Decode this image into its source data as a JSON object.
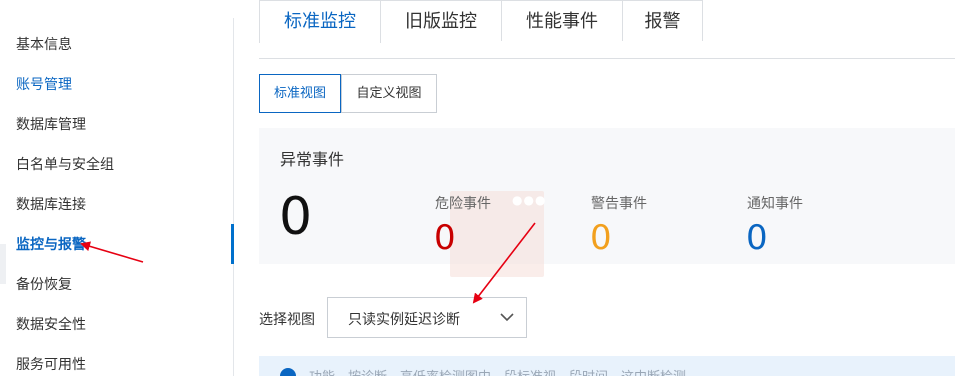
{
  "sidebar": {
    "items": [
      {
        "label": "基本信息"
      },
      {
        "label": "账号管理"
      },
      {
        "label": "数据库管理"
      },
      {
        "label": "白名单与安全组"
      },
      {
        "label": "数据库连接"
      },
      {
        "label": "监控与报警"
      },
      {
        "label": "备份恢复"
      },
      {
        "label": "数据安全性"
      },
      {
        "label": "服务可用性"
      }
    ]
  },
  "tabs": [
    {
      "label": "标准监控"
    },
    {
      "label": "旧版监控"
    },
    {
      "label": "性能事件"
    },
    {
      "label": "报警"
    }
  ],
  "views": [
    {
      "label": "标准视图"
    },
    {
      "label": "自定义视图"
    }
  ],
  "events": {
    "title": "异常事件",
    "total": "0",
    "danger": {
      "label": "危险事件",
      "value": "0",
      "color": "#c80000"
    },
    "warning": {
      "label": "警告事件",
      "value": "0",
      "color": "#f2a01e"
    },
    "notice": {
      "label": "通知事件",
      "value": "0",
      "color": "#0a66c2"
    }
  },
  "select_view": {
    "label": "选择视图",
    "value": "只读实例延迟诊断"
  },
  "info_bar": {
    "text": "功能…按诊断…高低率检测图中…段标准视…段时间…这中断检测"
  },
  "colors": {
    "accent": "#0a66c2",
    "annotation_arrow": "#e60012"
  }
}
